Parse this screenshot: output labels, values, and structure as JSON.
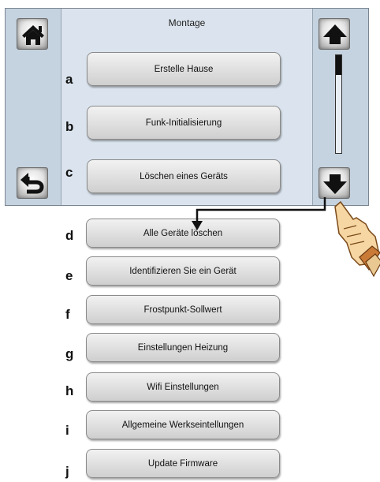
{
  "screen": {
    "title": "Montage",
    "home_icon": "home-icon",
    "back_icon": "undo-arrow-icon",
    "up_icon": "arrow-up-icon",
    "down_icon": "arrow-down-icon"
  },
  "scrollbar": {
    "position_fraction": 0.0,
    "thumb_fraction": 0.2
  },
  "items": [
    {
      "letter": "a",
      "label": "Erstelle Hause"
    },
    {
      "letter": "b",
      "label": "Funk-Initialisierung"
    },
    {
      "letter": "c",
      "label": "Löschen eines Geräts"
    },
    {
      "letter": "d",
      "label": "Alle Geräte löschen"
    },
    {
      "letter": "e",
      "label": "Identifizieren Sie ein Gerät"
    },
    {
      "letter": "f",
      "label": "Frostpunkt-Sollwert"
    },
    {
      "letter": "g",
      "label": "Einstellungen Heizung"
    },
    {
      "letter": "h",
      "label": "Wifi Einstellungen"
    },
    {
      "letter": "i",
      "label": "Allgemeine Werkseintellungen"
    },
    {
      "letter": "j",
      "label": "Update Firmware"
    }
  ],
  "annotation": {
    "hand_icon": "pointing-hand-icon",
    "connector": "arrow-connector"
  }
}
